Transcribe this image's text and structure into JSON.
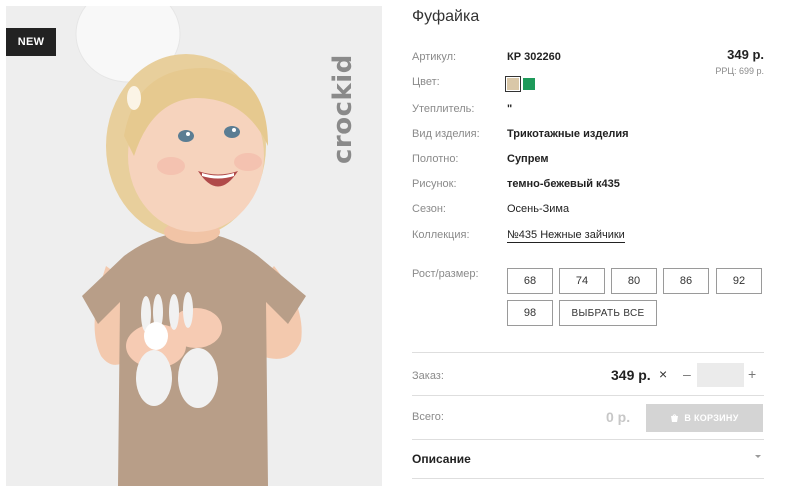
{
  "product": {
    "title": "Фуфайка",
    "badge": "NEW",
    "brand": "crockid",
    "price": "349 р.",
    "rrp": "РРЦ: 699 р."
  },
  "attributes": [
    {
      "label": "Артикул:",
      "value": "КР 302260"
    },
    {
      "label": "Цвет:",
      "value": ""
    },
    {
      "label": "Утеплитель:",
      "value": "\""
    },
    {
      "label": "Вид изделия:",
      "value": "Трикотажные изделия"
    },
    {
      "label": "Полотно:",
      "value": "Супрем"
    },
    {
      "label": "Рисунок:",
      "value": "темно-бежевый к435"
    },
    {
      "label": "Сезон:",
      "value": "Осень-Зима"
    },
    {
      "label": "Коллекция:",
      "value": "№435 Нежные зайчики"
    }
  ],
  "colors": [
    {
      "name": "beige",
      "hex": "#d9c7a8",
      "selected": true
    },
    {
      "name": "green",
      "hex": "#1e9a5a",
      "selected": false
    }
  ],
  "sizes": {
    "label": "Рост/размер:",
    "options": [
      "68",
      "74",
      "80",
      "86",
      "92",
      "98"
    ],
    "select_all": "ВЫБРАТЬ ВСЕ"
  },
  "order": {
    "label": "Заказ:",
    "price": "349 р.",
    "times": "×",
    "minus": "–",
    "plus": "+",
    "quantity": ""
  },
  "total": {
    "label": "Всего:",
    "value": "0 р.",
    "cart_button": "В КОРЗИНУ"
  },
  "description": {
    "label": "Описание"
  }
}
